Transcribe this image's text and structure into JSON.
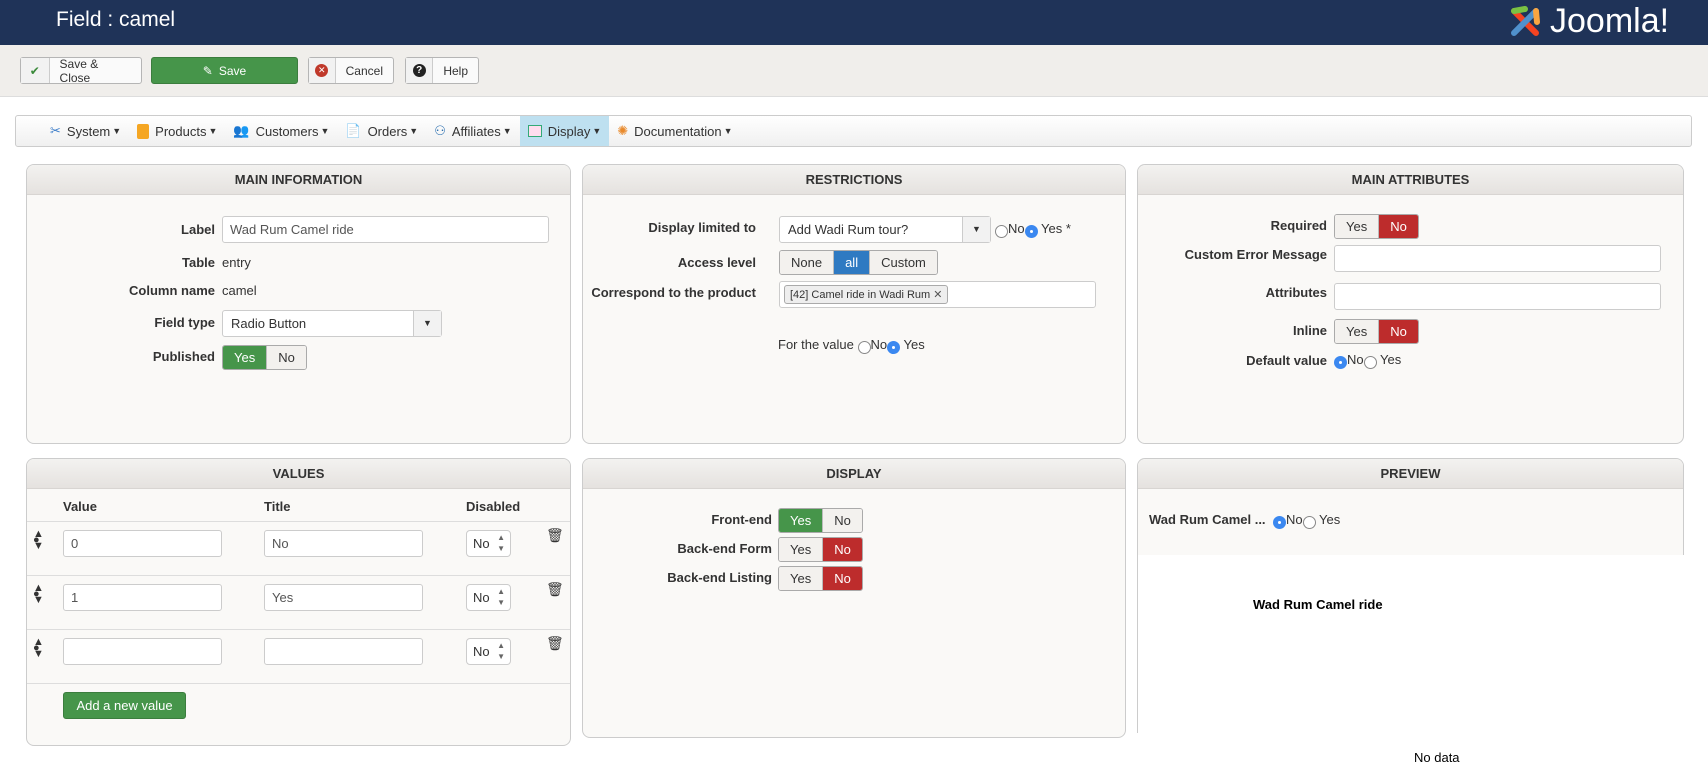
{
  "header": {
    "title": "Field : camel",
    "logo": "Joomla!"
  },
  "toolbar": {
    "save_close": "Save & Close",
    "save": "Save",
    "cancel": "Cancel",
    "help": "Help"
  },
  "menu": [
    {
      "label": "System",
      "icon": "tools-icon"
    },
    {
      "label": "Products",
      "icon": "box-icon"
    },
    {
      "label": "Customers",
      "icon": "users-icon"
    },
    {
      "label": "Orders",
      "icon": "document-icon"
    },
    {
      "label": "Affiliates",
      "icon": "affiliates-icon"
    },
    {
      "label": "Display",
      "icon": "display-icon",
      "active": true
    },
    {
      "label": "Documentation",
      "icon": "lifebuoy-icon"
    }
  ],
  "main_info": {
    "title": "MAIN INFORMATION",
    "label_lbl": "Label",
    "label_val": "Wad Rum Camel ride",
    "table_lbl": "Table",
    "table_val": "entry",
    "column_lbl": "Column name",
    "column_val": "camel",
    "type_lbl": "Field type",
    "type_val": "Radio Button",
    "published_lbl": "Published",
    "yes": "Yes",
    "no": "No",
    "published": "Yes"
  },
  "restrictions": {
    "title": "RESTRICTIONS",
    "display_lbl": "Display limited to",
    "display_val": "Add Wadi Rum tour?",
    "no": "No",
    "yes": "Yes *",
    "access_lbl": "Access level",
    "access": [
      "None",
      "all",
      "Custom"
    ],
    "access_selected": "all",
    "product_lbl": "Correspond to the product",
    "product_tag": "[42] Camel ride in Wadi Rum",
    "for_value": "For the value",
    "fv_no": "No",
    "fv_yes": "Yes",
    "fv_selected": "Yes"
  },
  "attributes": {
    "title": "MAIN ATTRIBUTES",
    "required_lbl": "Required",
    "required": "No",
    "error_lbl": "Custom Error Message",
    "error_val": "",
    "attr_lbl": "Attributes",
    "attr_val": "",
    "inline_lbl": "Inline",
    "inline": "No",
    "default_lbl": "Default value",
    "yes": "Yes",
    "no": "No",
    "default": "No"
  },
  "values": {
    "title": "VALUES",
    "cols": [
      "Value",
      "Title",
      "Disabled"
    ],
    "rows": [
      {
        "value": "0",
        "title": "No",
        "disabled": "No"
      },
      {
        "value": "1",
        "title": "Yes",
        "disabled": "No"
      },
      {
        "value": "",
        "title": "",
        "disabled": "No"
      }
    ],
    "add": "Add a new value"
  },
  "display": {
    "title": "DISPLAY",
    "front_lbl": "Front-end",
    "front": "Yes",
    "bform_lbl": "Back-end Form",
    "bform": "No",
    "blist_lbl": "Back-end Listing",
    "blist": "No",
    "yes": "Yes",
    "no": "No"
  },
  "preview": {
    "title": "PREVIEW",
    "label": "Wad Rum Camel ...",
    "no": "No",
    "yes": "Yes",
    "selected": "No",
    "chart_title": "Wad Rum Camel ride",
    "no_data": "No data"
  }
}
